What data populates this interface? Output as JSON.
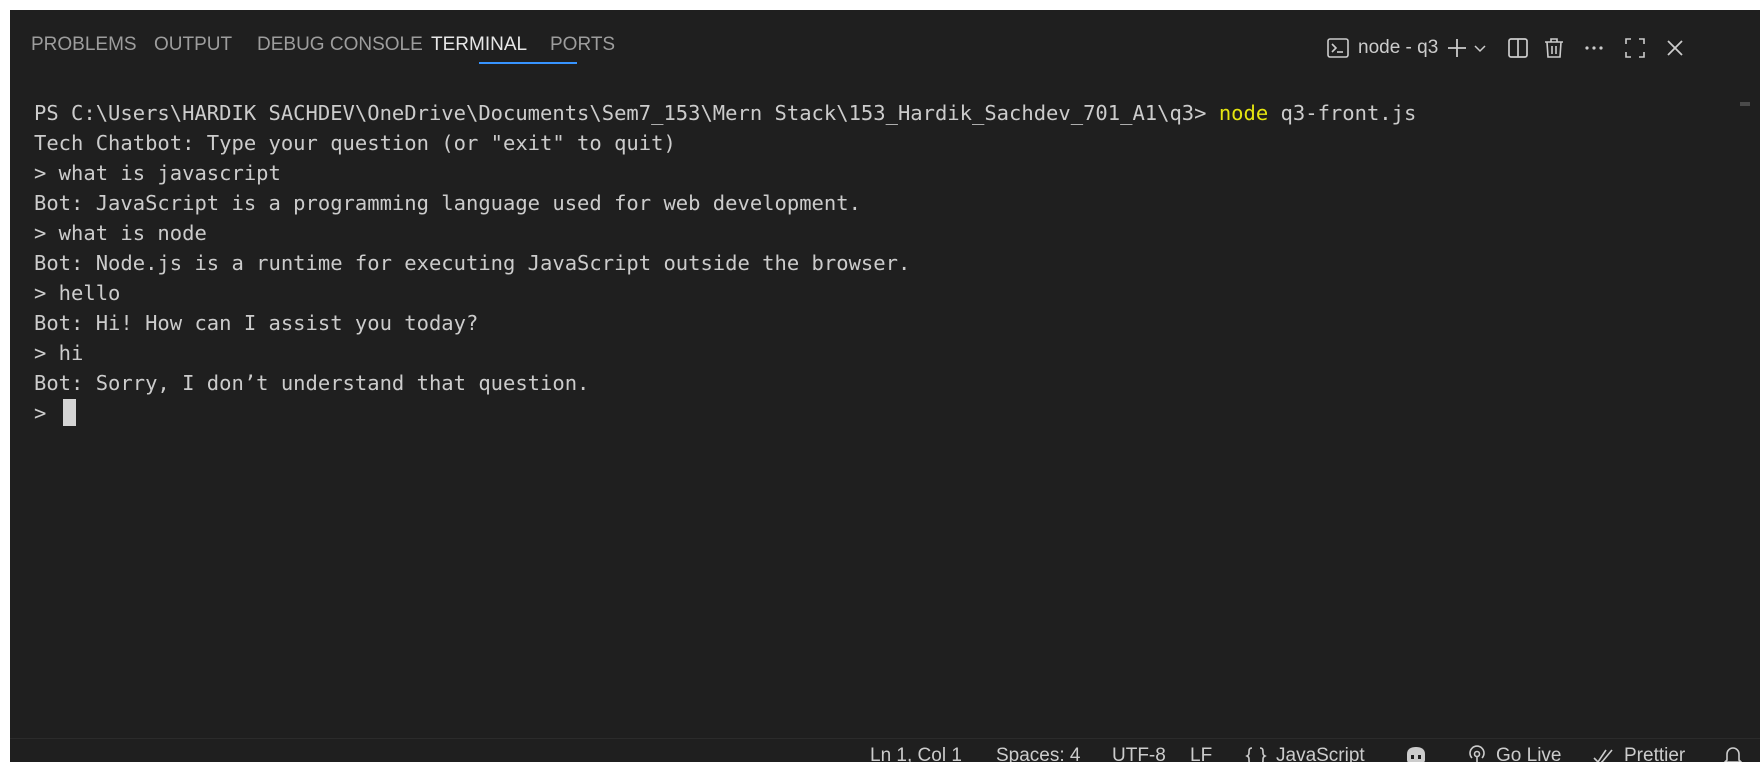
{
  "tabs": [
    {
      "label": "PROBLEMS",
      "active": false
    },
    {
      "label": "OUTPUT",
      "active": false
    },
    {
      "label": "DEBUG CONSOLE",
      "active": false
    },
    {
      "label": "TERMINAL",
      "active": true
    },
    {
      "label": "PORTS",
      "active": false
    }
  ],
  "terminal_instance": {
    "name": "node - q3",
    "icons": [
      "terminal-icon",
      "plus-icon",
      "chevron-down-icon",
      "split-icon",
      "trash-icon",
      "ellipsis-icon",
      "maximize-icon",
      "close-icon"
    ]
  },
  "terminal": {
    "prompt": "PS C:\\Users\\HARDIK SACHDEV\\OneDrive\\Documents\\Sem7_153\\Mern Stack\\153_Hardik_Sachdev_701_A1\\q3> ",
    "command_keyword": "node",
    "command_args": " q3-front.js",
    "lines": [
      "Tech Chatbot: Type your question (or \"exit\" to quit)",
      "> what is javascript",
      "Bot: JavaScript is a programming language used for web development.",
      "> what is node",
      "Bot: Node.js is a runtime for executing JavaScript outside the browser.",
      "> hello",
      "Bot: Hi! How can I assist you today?",
      "> hi",
      "Bot: Sorry, I don’t understand that question."
    ],
    "input_prompt": "> "
  },
  "status_bar": {
    "position": "Ln 1, Col 1",
    "spaces": "Spaces: 4",
    "encoding": "UTF-8",
    "eol": "LF",
    "language": "JavaScript",
    "go_live": "Go Live",
    "prettier": "Prettier"
  },
  "colors": {
    "background": "#1f1f1f",
    "accent": "#3794ff",
    "command": "#e5e510",
    "text": "#cccccc"
  }
}
